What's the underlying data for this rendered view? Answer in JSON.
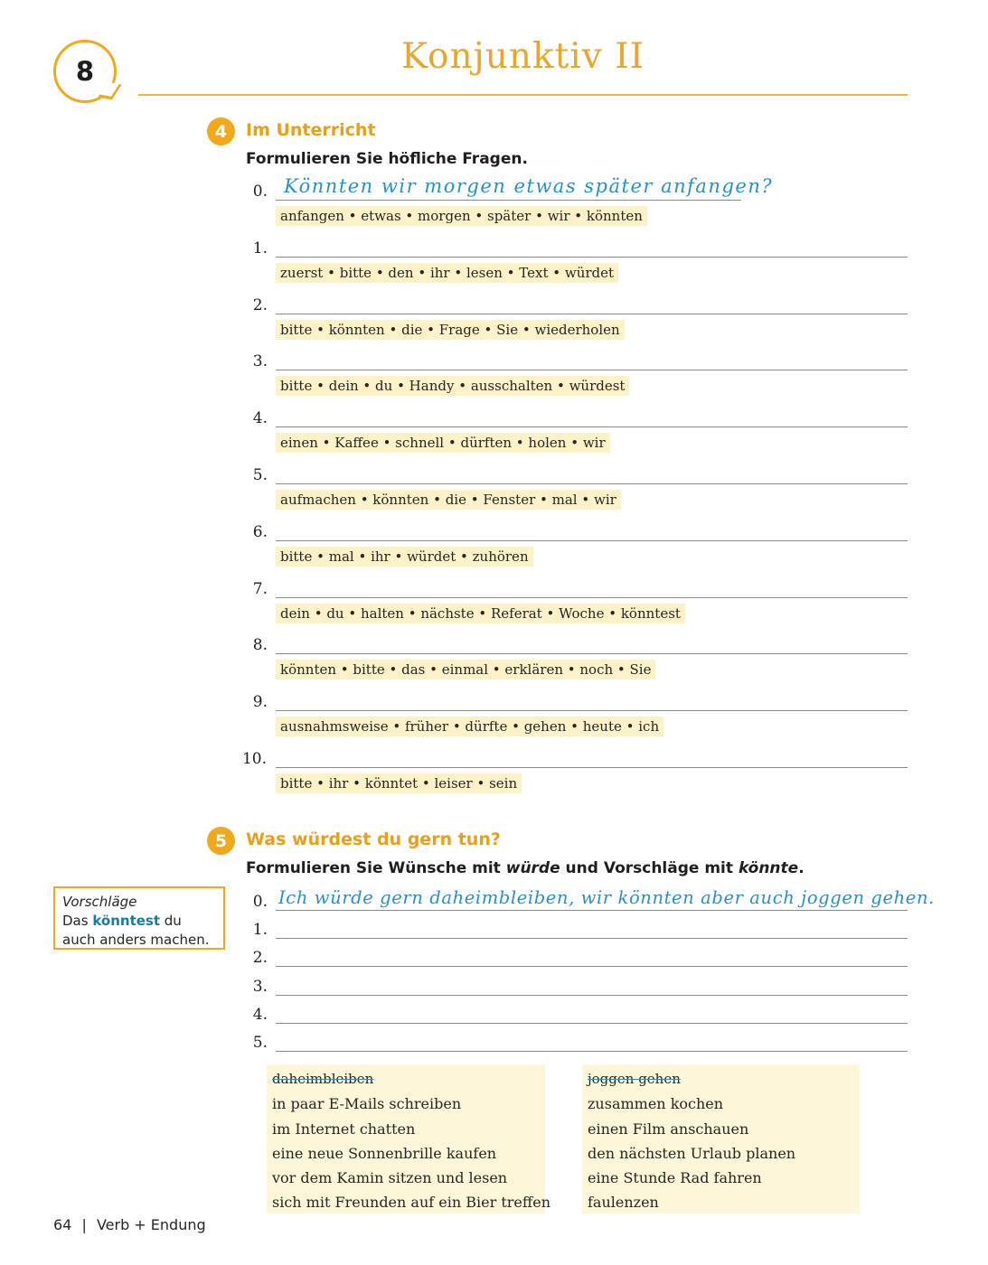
{
  "chapter": {
    "number": "8",
    "title": "Konjunktiv II"
  },
  "exercise4": {
    "number": "4",
    "title": "Im Unterricht",
    "instruction": "Formulieren Sie höfliche Fragen.",
    "example_answer": "Könnten wir morgen etwas später anfangen?",
    "items": [
      {
        "label": "0.",
        "hint": "anfangen • etwas • morgen • später • wir • könnten"
      },
      {
        "label": "1.",
        "hint": "zuerst • bitte • den • ihr • lesen • Text • würdet"
      },
      {
        "label": "2.",
        "hint": "bitte • könnten • die • Frage • Sie • wiederholen"
      },
      {
        "label": "3.",
        "hint": "bitte • dein • du • Handy • ausschalten • würdest"
      },
      {
        "label": "4.",
        "hint": "einen • Kaffee • schnell • dürften • holen • wir"
      },
      {
        "label": "5.",
        "hint": "aufmachen • könnten • die • Fenster • mal • wir"
      },
      {
        "label": "6.",
        "hint": "bitte • mal • ihr • würdet • zuhören"
      },
      {
        "label": "7.",
        "hint": "dein • du • halten • nächste • Referat • Woche • könntest"
      },
      {
        "label": "8.",
        "hint": "könnten • bitte • das • einmal • erklären • noch • Sie"
      },
      {
        "label": "9.",
        "hint": "ausnahmsweise • früher • dürfte • gehen • heute • ich"
      },
      {
        "label": "10.",
        "hint": "bitte • ihr • könntet • leiser • sein"
      }
    ]
  },
  "exercise5": {
    "number": "5",
    "title": "Was würdest du gern tun?",
    "instruction_parts": [
      "Formulieren Sie Wünsche mit ",
      "würde",
      " und Vorschläge mit ",
      "könnte",
      "."
    ],
    "example_answer": "Ich würde gern daheimbleiben, wir könnten aber auch joggen gehen.",
    "labels": [
      "0.",
      "1.",
      "2.",
      "3.",
      "4.",
      "5."
    ],
    "sidebar": {
      "heading": "Vorschläge",
      "pre": "Das ",
      "bold": "könntest",
      "post": " du auch anders machen."
    },
    "wishes": [
      "daheimbleiben",
      "in paar E-Mails schreiben",
      "im Internet chatten",
      "eine neue Sonnenbrille kaufen",
      "vor dem Kamin sitzen und lesen",
      "sich mit Freunden auf ein Bier treffen"
    ],
    "suggestions": [
      "joggen gehen",
      "zusammen kochen",
      "einen Film anschauen",
      "den nächsten Urlaub planen",
      "eine Stunde Rad fahren",
      "faulenzen"
    ]
  },
  "footer": {
    "page": "64",
    "separator": "|",
    "section": "Verb + Endung"
  }
}
